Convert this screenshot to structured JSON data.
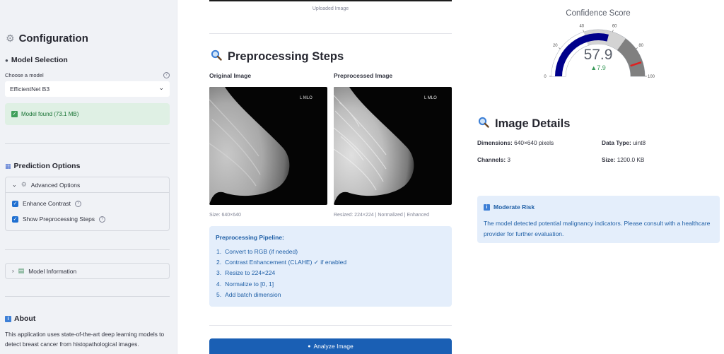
{
  "sidebar": {
    "config_title": "Configuration",
    "model_selection_title": "Model Selection",
    "choose_model_label": "Choose a model",
    "selected_model": "EfficientNet B3",
    "model_status": "Model found (73.1 MB)",
    "prediction_options_title": "Prediction Options",
    "advanced_options_label": "Advanced Options",
    "enhance_contrast_label": "Enhance Contrast",
    "show_preprocessing_label": "Show Preprocessing Steps",
    "model_information_label": "Model Information",
    "about_title": "About",
    "about_text": "This application uses state-of-the-art deep learning models to detect breast cancer from histopathological images."
  },
  "main": {
    "uploaded_caption": "Uploaded Image",
    "preprocessing_title": "Preprocessing Steps",
    "original_label": "Original Image",
    "preprocessed_label": "Preprocessed Image",
    "image_marker": "L MLO",
    "original_caption": "Size: 640×640",
    "preprocessed_caption": "Resized: 224×224 | Normalized | Enhanced",
    "pipeline_title": "Preprocessing Pipeline:",
    "pipeline_steps": [
      "Convert to RGB (if needed)",
      "Contrast Enhancement (CLAHE) ✓ if enabled",
      "Resize to 224×224",
      "Normalize to [0, 1]",
      "Add batch dimension"
    ],
    "analyze_button": "Analyze Image"
  },
  "gauge": {
    "title": "Confidence Score",
    "value": 57.9,
    "value_text": "57.9",
    "delta_text": "▲7.9",
    "min": 0,
    "max": 100,
    "tick_labels": [
      "0",
      "20",
      "40",
      "60",
      "80",
      "100"
    ],
    "threshold": 90,
    "bar_color": "#00008b",
    "band_colors": [
      "#ffffff",
      "#d3d3d3",
      "#808080"
    ],
    "threshold_color": "#e02020",
    "delta_color": "#3a9a5a"
  },
  "details": {
    "title": "Image Details",
    "dimensions_label": "Dimensions:",
    "dimensions_value": "640×640 pixels",
    "data_type_label": "Data Type:",
    "data_type_value": "uint8",
    "channels_label": "Channels:",
    "channels_value": "3",
    "size_label": "Size:",
    "size_value": "1200.0 KB"
  },
  "risk": {
    "title": "Moderate Risk",
    "message": "The model detected potential malignancy indicators. Please consult with a healthcare provider for further evaluation."
  }
}
